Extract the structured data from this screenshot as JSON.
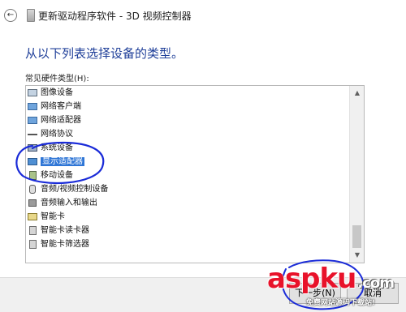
{
  "window": {
    "title": "更新驱动程序软件 - 3D 视频控制器",
    "back_glyph": "←"
  },
  "main": {
    "heading": "从以下列表选择设备的类型。",
    "list_label": "常见硬件类型(H):",
    "items": [
      {
        "label": "图像设备",
        "icon": "imaging-device-icon"
      },
      {
        "label": "网络客户端",
        "icon": "network-client-icon"
      },
      {
        "label": "网络适配器",
        "icon": "network-adapter-icon"
      },
      {
        "label": "网络协议",
        "icon": "network-protocol-icon"
      },
      {
        "label": "系统设备",
        "icon": "system-device-icon"
      },
      {
        "label": "显示适配器",
        "icon": "display-adapter-icon",
        "selected": true
      },
      {
        "label": "移动设备",
        "icon": "mobile-device-icon"
      },
      {
        "label": "音频/视频控制设备",
        "icon": "audio-video-controller-icon"
      },
      {
        "label": "音频输入和输出",
        "icon": "audio-io-icon"
      },
      {
        "label": "智能卡",
        "icon": "smart-card-icon"
      },
      {
        "label": "智能卡读卡器",
        "icon": "smart-card-reader-icon"
      },
      {
        "label": "智能卡筛选器",
        "icon": "smart-card-filter-icon"
      }
    ]
  },
  "scrollbar": {
    "up_glyph": "▲",
    "down_glyph": "▼"
  },
  "footer": {
    "next_label": "下一步(N)",
    "cancel_label": "取消"
  },
  "watermark": {
    "brand": "asp",
    "brand_suffix": "ku",
    "tld": ".com",
    "subtitle": "免费网站源码下载站!"
  },
  "colors": {
    "heading": "#1f3f99",
    "selection": "#2f76d6",
    "annotation": "#1a2bd8",
    "watermark": "#e8122a"
  }
}
